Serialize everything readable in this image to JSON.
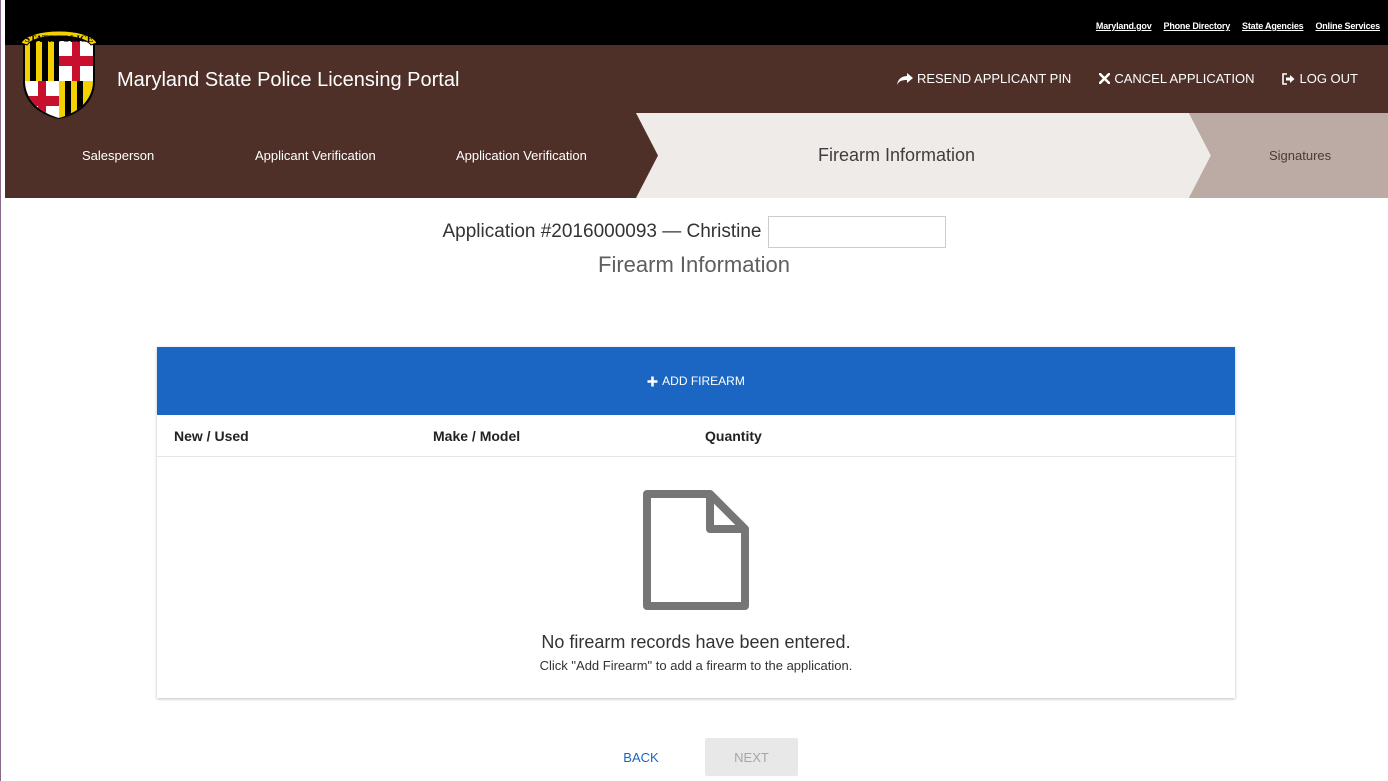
{
  "utility": {
    "links": [
      "Maryland.gov",
      "Phone Directory",
      "State Agencies",
      "Online Services"
    ]
  },
  "header": {
    "title": "Maryland State Police Licensing Portal",
    "logo_text": "STATE POLICE",
    "actions": {
      "resend_pin": "RESEND APPLICANT PIN",
      "cancel": "CANCEL APPLICATION",
      "logout": "LOG OUT"
    }
  },
  "steps": {
    "salesperson": "Salesperson",
    "applicant_verification": "Applicant Verification",
    "application_verification": "Application Verification",
    "firearm_information": "Firearm Information",
    "signatures": "Signatures",
    "active": "Firearm Information"
  },
  "page": {
    "application_title": "Application #2016000093 — Christine",
    "name_field_value": "",
    "subtitle": "Firearm Information"
  },
  "table": {
    "add_label": "ADD FIREARM",
    "columns": [
      "New / Used",
      "Make / Model",
      "Quantity"
    ],
    "rows": [],
    "empty_message": "No firearm records have been entered.",
    "empty_hint": "Click \"Add Firearm\" to add a firearm to the application."
  },
  "footer": {
    "back": "BACK",
    "next": "NEXT"
  },
  "colors": {
    "header_bg": "#4e3029",
    "step_active_bg": "#efebe9",
    "step_upcoming_bg": "#bcaaa4",
    "primary": "#1a66c2"
  }
}
